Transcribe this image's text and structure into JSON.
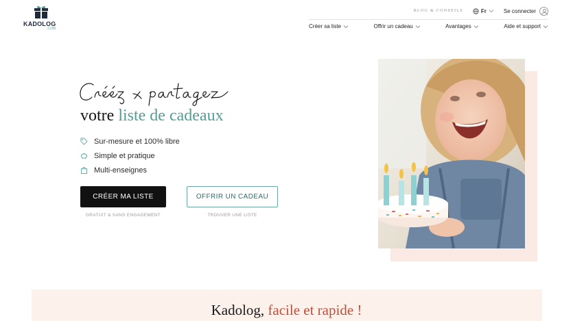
{
  "header": {
    "logo": {
      "brand": "KADOLOG",
      "suffix": ".COM"
    },
    "blog_link": "BLOG & CONSEILS",
    "language": "Fr",
    "login": "Se connecter",
    "nav": [
      {
        "label": "Créer sa liste",
        "icon": "chevron-down-icon"
      },
      {
        "label": "Offrir un cadeau",
        "icon": "chevron-down-icon"
      },
      {
        "label": "Avantages",
        "icon": "chevron-down-icon"
      },
      {
        "label": "Aide et support",
        "icon": "chevron-down-icon"
      }
    ]
  },
  "hero": {
    "script_title": "Créez & partagez",
    "title_plain": "votre ",
    "title_accent": "liste de cadeaux",
    "features": [
      {
        "label": "Sur-mesure et 100% libre",
        "icon": "tag-icon"
      },
      {
        "label": "Simple et pratique",
        "icon": "piggy-bank-icon"
      },
      {
        "label": "Multi-enseignes",
        "icon": "shopping-bag-icon"
      }
    ],
    "primary_button": "CRÉER MA LISTE",
    "primary_note": "GRATUIT & SANS ENGAGEMENT",
    "secondary_button": "OFFRIR UN CADEAU",
    "secondary_note": "TROUVER UNE LISTE"
  },
  "band": {
    "title_plain": "Kadolog, ",
    "title_accent": "facile et rapide !"
  },
  "colors": {
    "accent_teal": "#4e9f97",
    "accent_red": "#c0503a",
    "photo_backdrop": "#fbe9e3",
    "band_background": "#fdf1ec",
    "primary_button": "#111111"
  }
}
